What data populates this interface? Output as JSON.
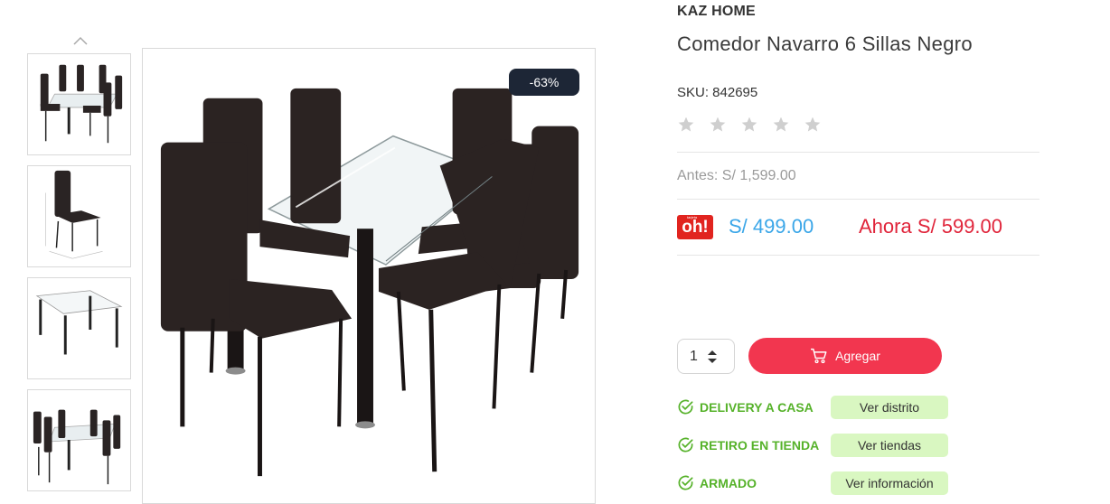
{
  "product": {
    "brand": "KAZ HOME",
    "title": "Comedor Navarro 6 Sillas Negro",
    "sku": "SKU: 842695",
    "rating": 0,
    "rating_max": 5,
    "discount_badge": "-63%"
  },
  "pricing": {
    "before": "Antes: S/ 1,599.00",
    "oh_logo_small": "tarjeta",
    "oh_logo": "oh!",
    "oh_price": "S/ 499.00",
    "now_price": "Ahora S/ 599.00"
  },
  "cart": {
    "quantity": "1",
    "add_label": "Agregar"
  },
  "services": [
    {
      "label": "DELIVERY A CASA",
      "button": "Ver distrito"
    },
    {
      "label": "RETIRO EN TIENDA",
      "button": "Ver tiendas"
    },
    {
      "label": "ARMADO",
      "button": "Ver información"
    }
  ],
  "colors": {
    "accent_red": "#f2364f",
    "oh_blue": "#3aa6e8",
    "now_red": "#e0243a",
    "service_green": "#56b22a",
    "service_btn_bg": "#d9f7c1",
    "badge_bg": "#1d2636"
  },
  "icons": {
    "gallery_up": "chevron-up-icon",
    "star": "star-icon",
    "cart": "cart-icon",
    "service_check": "check-circle-icon",
    "quantity_stepper": "sort-arrows-icon"
  }
}
